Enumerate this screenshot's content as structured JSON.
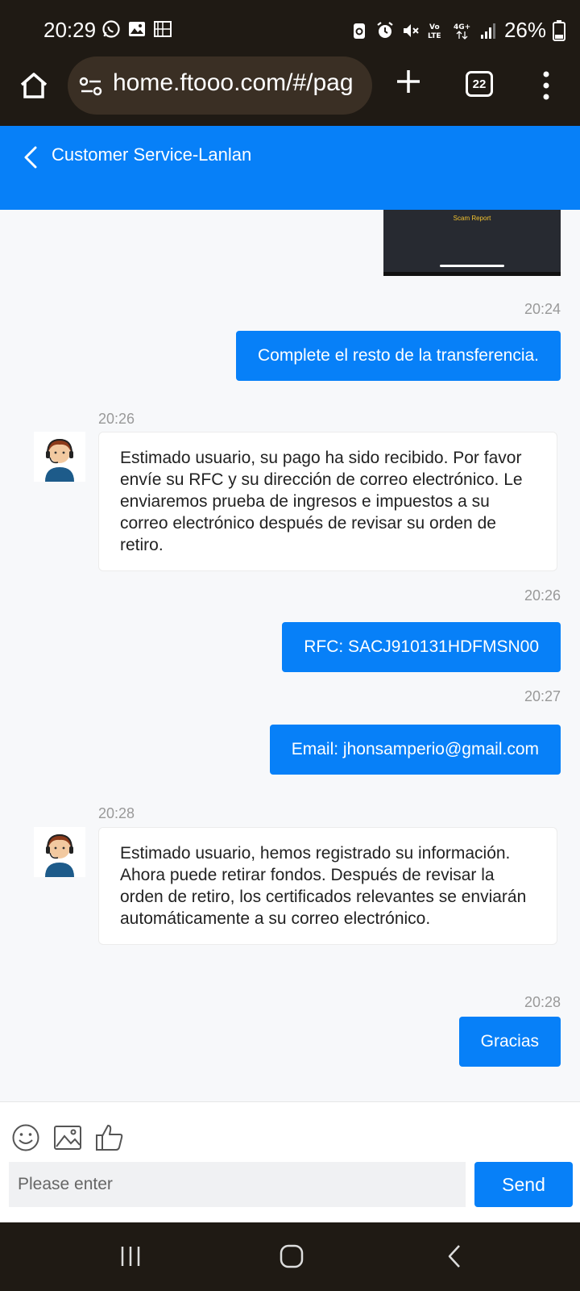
{
  "status_bar": {
    "time": "20:29",
    "battery": "26%",
    "left_icons": [
      "whatsapp-icon",
      "gallery-icon",
      "cast-icon"
    ],
    "right_icons": [
      "battery-saver-icon",
      "alarm-icon",
      "mute-icon",
      "volte-icon",
      "4g-icon",
      "signal-icon",
      "battery-icon"
    ]
  },
  "browser": {
    "url": "home.ftooo.com/#/pag",
    "tab_count": "22"
  },
  "header": {
    "title": "Customer Service-Lanlan"
  },
  "preview": {
    "text": "Scam Report"
  },
  "messages": [
    {
      "direction": "out",
      "time": "20:24",
      "text": "Complete el resto de la transferencia."
    },
    {
      "direction": "in",
      "time": "20:26",
      "text": "Estimado usuario, su pago ha sido recibido. Por favor envíe su RFC y su dirección de correo electrónico. Le enviaremos prueba de ingresos e impuestos a su correo electrónico después de revisar su orden de retiro."
    },
    {
      "direction": "out",
      "time": "20:26",
      "text": "RFC: SACJ910131HDFMSN00"
    },
    {
      "direction": "out",
      "time": "20:27",
      "text": "Email: jhonsamperio@gmail.com"
    },
    {
      "direction": "in",
      "time": "20:28",
      "text": "Estimado usuario, hemos registrado su información. Ahora puede retirar fondos. Después de revisar la orden de retiro, los certificados relevantes se enviarán automáticamente a su correo electrónico."
    },
    {
      "direction": "out",
      "time": "20:28",
      "text": "Gracias"
    }
  ],
  "input": {
    "placeholder": "Please enter",
    "send_label": "Send"
  },
  "colors": {
    "accent": "#0780f8",
    "system_bar": "#1f1a14",
    "chat_bg": "#f7f8fa"
  }
}
